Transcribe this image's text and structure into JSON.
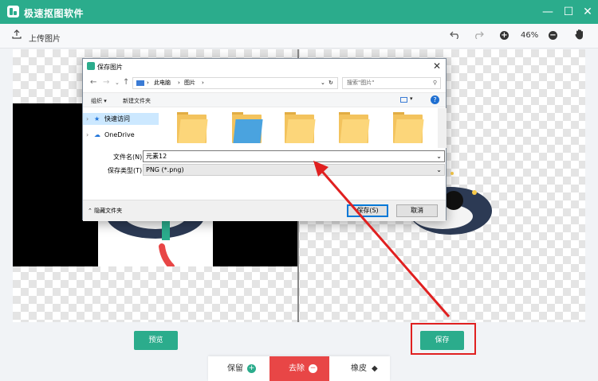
{
  "app": {
    "title": "极速抠图软件"
  },
  "window_controls": {
    "restore": "☐",
    "minimize": "—",
    "maximize": "☐",
    "close": "✕"
  },
  "toolbar": {
    "upload_label": "上传图片",
    "zoom": "46%"
  },
  "bottom": {
    "preview_label": "预览",
    "save_label": "保存"
  },
  "tabs": [
    {
      "label": "保留",
      "icon": "plus-icon",
      "color": "#2bac8c"
    },
    {
      "label": "去除",
      "icon": "minus-icon",
      "color": "#e84646"
    },
    {
      "label": "橡皮",
      "icon": "eraser-icon",
      "color": "#555555"
    }
  ],
  "dialog": {
    "title": "保存图片",
    "breadcrumb": [
      "此电脑",
      "图片"
    ],
    "search_placeholder": "搜索\"图片\"",
    "organize": "组织 ▾",
    "new_folder": "新建文件夹",
    "nav": [
      "快速访问",
      "OneDrive"
    ],
    "filename_label": "文件名(N):",
    "filename_value": "元素12",
    "filetype_label": "保存类型(T):",
    "filetype_value": "PNG (*.png)",
    "hide_folders": "隐藏文件夹",
    "save_btn": "保存(S)",
    "cancel_btn": "取消"
  },
  "colors": {
    "brand": "#2bac8c",
    "danger": "#e84646",
    "highlight": "#e02020"
  }
}
